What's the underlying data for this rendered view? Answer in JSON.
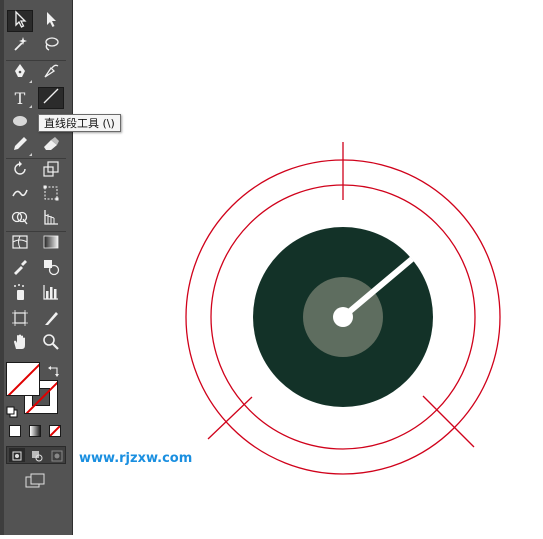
{
  "toolbar": {
    "tools": [
      {
        "name": "selection-tool",
        "icon": "selection-arrow-icon"
      },
      {
        "name": "direct-selection-tool",
        "icon": "direct-selection-arrow-icon"
      },
      {
        "name": "magic-wand-tool",
        "icon": "magic-wand-icon"
      },
      {
        "name": "lasso-tool",
        "icon": "lasso-icon"
      },
      {
        "name": "pen-tool",
        "icon": "pen-icon"
      },
      {
        "name": "curvature-tool",
        "icon": "curvature-pen-icon"
      },
      {
        "name": "type-tool",
        "icon": "type-icon",
        "glyph": "T"
      },
      {
        "name": "line-segment-tool",
        "icon": "line-segment-icon"
      },
      {
        "name": "ellipse-tool",
        "icon": "ellipse-icon"
      },
      {
        "name": "pencil-tool",
        "icon": "pencil-icon"
      },
      {
        "name": "eraser-tool",
        "icon": "eraser-icon"
      },
      {
        "name": "rotate-tool",
        "icon": "rotate-icon"
      },
      {
        "name": "scale-tool",
        "icon": "scale-icon"
      },
      {
        "name": "warp-tool",
        "icon": "warp-icon"
      },
      {
        "name": "free-transform-tool",
        "icon": "free-transform-icon"
      },
      {
        "name": "shape-builder-tool",
        "icon": "shape-builder-icon"
      },
      {
        "name": "perspective-grid-tool",
        "icon": "perspective-grid-icon"
      },
      {
        "name": "mesh-tool",
        "icon": "mesh-icon"
      },
      {
        "name": "gradient-tool",
        "icon": "gradient-icon"
      },
      {
        "name": "eyedropper-tool",
        "icon": "eyedropper-icon"
      },
      {
        "name": "blend-tool",
        "icon": "blend-icon"
      },
      {
        "name": "symbol-sprayer-tool",
        "icon": "symbol-sprayer-icon"
      },
      {
        "name": "column-graph-tool",
        "icon": "column-graph-icon"
      },
      {
        "name": "artboard-tool",
        "icon": "artboard-icon"
      },
      {
        "name": "slice-tool",
        "icon": "slice-icon"
      },
      {
        "name": "hand-tool",
        "icon": "hand-icon"
      },
      {
        "name": "zoom-tool",
        "icon": "zoom-icon"
      }
    ],
    "active_tool": "line-segment-tool",
    "tooltip": "直线段工具 (\\)",
    "fill_color": "none",
    "stroke_color": "none"
  },
  "watermark": "www.rjzxw.com",
  "colors": {
    "toolbar_bg": "#535353",
    "canvas_bg": "#ffffff",
    "guide_red": "#d0021b",
    "dial_dark": "#133228",
    "hub_gray": "#5e6d5f",
    "needle": "#ffffff",
    "watermark": "#1a8fe0"
  }
}
